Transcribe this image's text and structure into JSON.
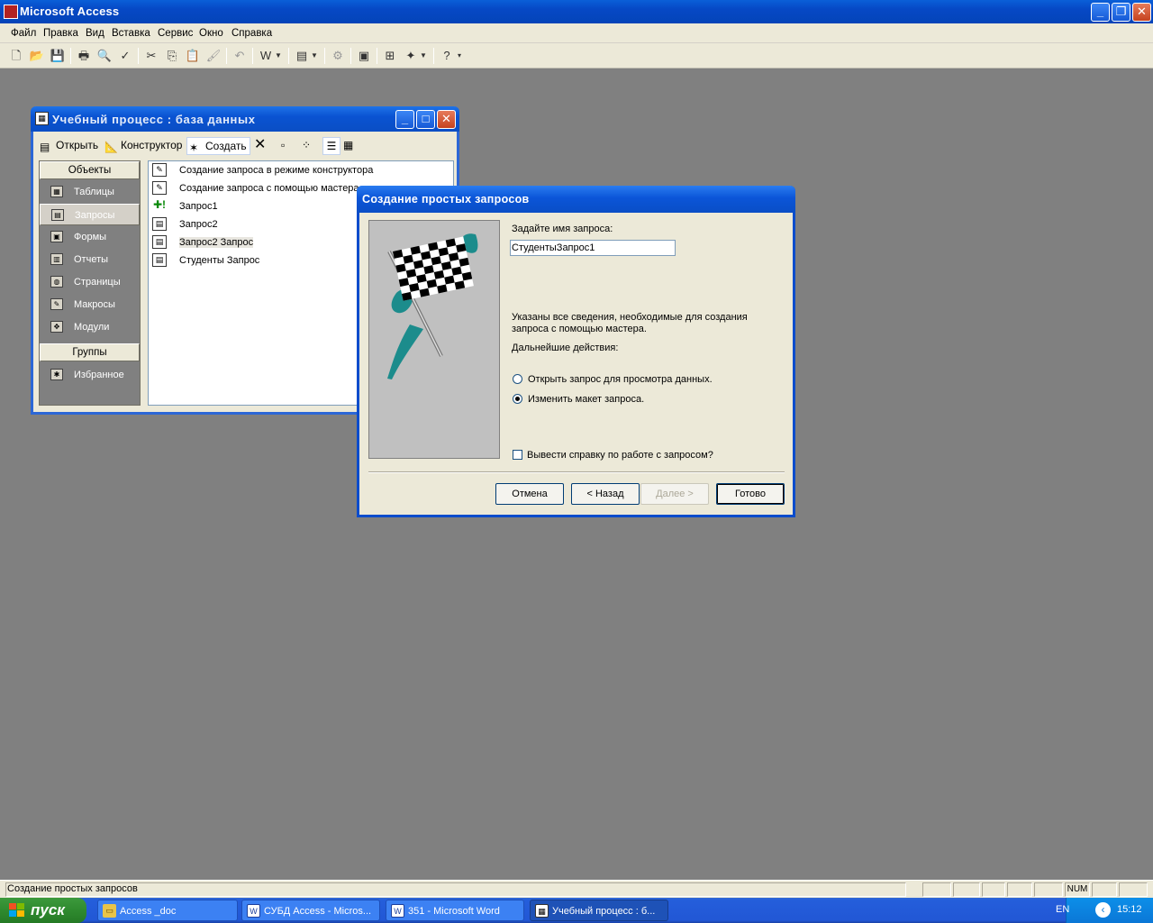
{
  "app": {
    "title": "Microsoft Access"
  },
  "menu": [
    "Файл",
    "Правка",
    "Вид",
    "Вставка",
    "Сервис",
    "Окно",
    "Справка"
  ],
  "menu_underline": [
    "Ф",
    "П",
    "В",
    "В",
    "С",
    "О",
    "С"
  ],
  "dbwindow": {
    "title": "Учебный процесс : база данных",
    "toolbar": {
      "open": "Открыть",
      "design": "Конструктор",
      "create": "Создать"
    },
    "objects_header": "Объекты",
    "objects": [
      "Таблицы",
      "Запросы",
      "Формы",
      "Отчеты",
      "Страницы",
      "Макросы",
      "Модули"
    ],
    "groups_header": "Группы",
    "groups": [
      "Избранное"
    ],
    "list": [
      "Создание запроса в режиме конструктора",
      "Создание запроса с помощью мастера",
      "Запрос1",
      "Запрос2",
      "Запрос2 Запрос",
      "Студенты Запрос"
    ]
  },
  "wizard": {
    "title": "Создание простых запросов",
    "name_prompt": "Задайте имя запроса:",
    "name_value": "СтудентыЗапрос1",
    "info_line1": "Указаны все сведения, необходимые для создания",
    "info_line2": "запроса с помощью мастера.",
    "next_actions": "Дальнейшие действия:",
    "option_open": "Открыть запрос для просмотра данных.",
    "option_modify": "Изменить макет запроса.",
    "selected_option": "modify",
    "help_checkbox": "Вывести справку по работе с запросом?",
    "help_checked": false,
    "buttons": {
      "cancel": "Отмена",
      "back": "< Назад",
      "next": "Далее >",
      "finish": "Готово"
    }
  },
  "statusbar": {
    "text": "Создание простых запросов",
    "num": "NUM"
  },
  "taskbar": {
    "start": "пуск",
    "tasks": [
      "Access _doc",
      "СУБД Access - Micros...",
      "351 - Microsoft Word",
      "Учебный процесс : б..."
    ],
    "lang": "EN",
    "time": "15:12"
  },
  "colors": {
    "desktop": "#808080",
    "titlebar": "#0a53d2",
    "dialog": "#ece9d8",
    "start": "#2f8a2f"
  }
}
